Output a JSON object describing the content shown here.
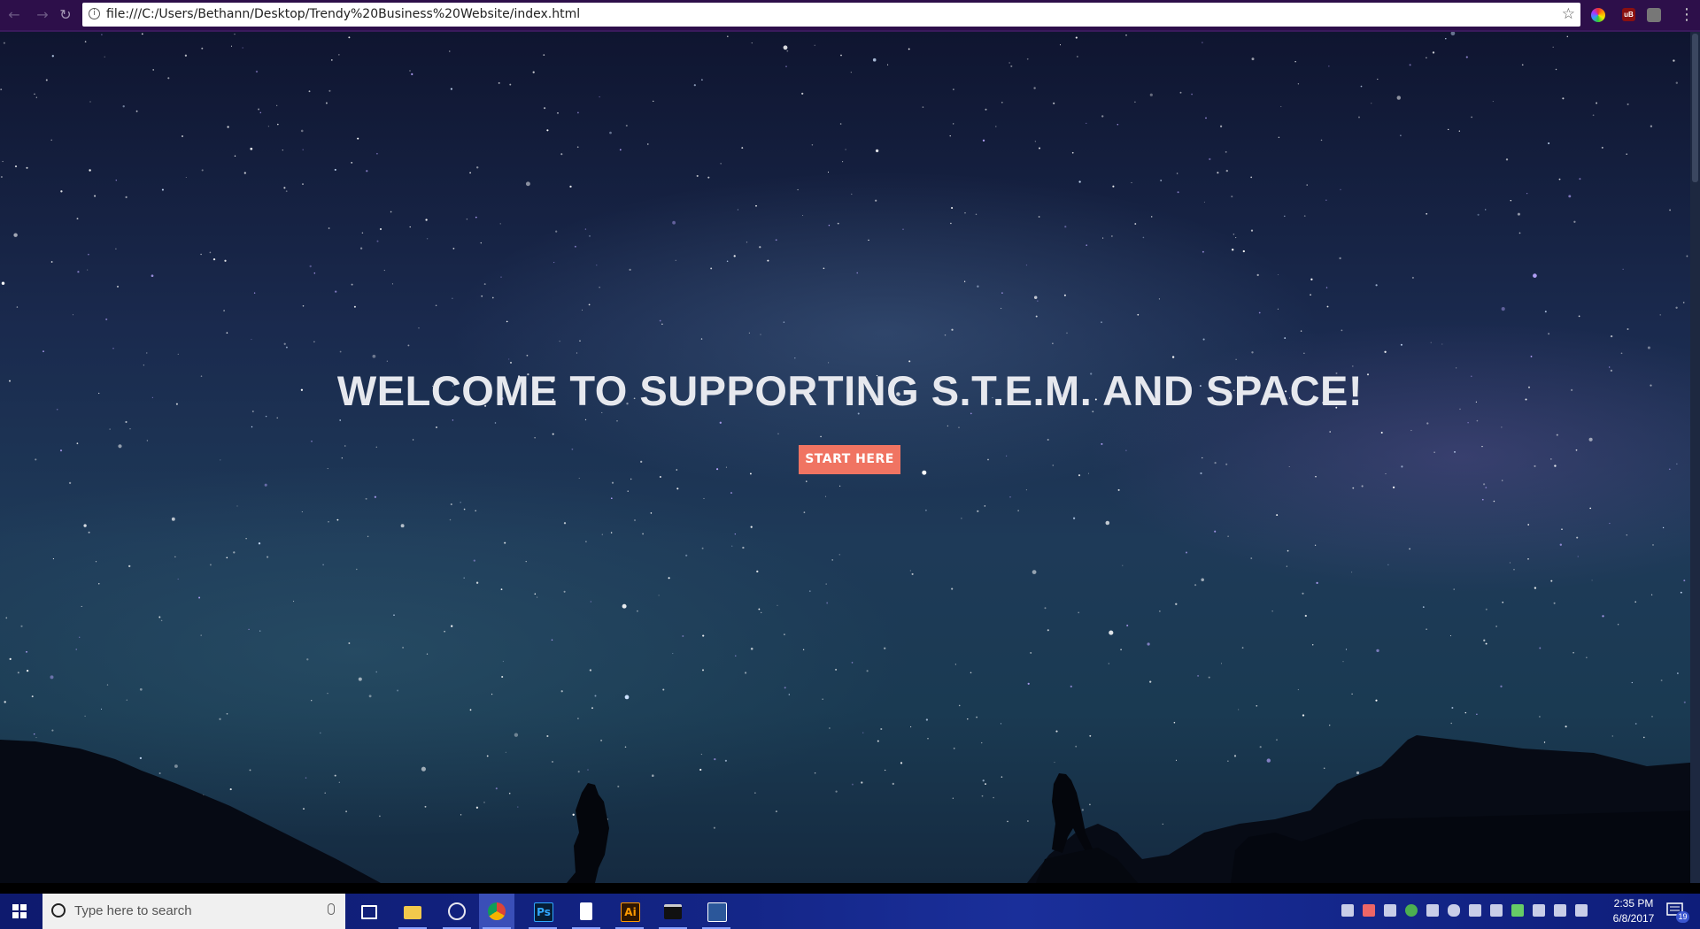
{
  "browser": {
    "url": "file:///C:/Users/Bethann/Desktop/Trendy%20Business%20Website/index.html",
    "back_icon": "arrow-left-icon",
    "forward_icon": "arrow-right-icon",
    "reload_icon": "reload-icon",
    "info_icon": "info-icon",
    "bookmark_icon": "star-icon",
    "extensions": [
      "color-picker-icon",
      "ublock-icon",
      "lock-extension-icon"
    ],
    "ublock_badge": "6",
    "menu_icon": "kebab-menu-icon"
  },
  "hero": {
    "title": "WELCOME TO SUPPORTING S.T.E.M. AND SPACE!",
    "button_label": "START HERE",
    "button_color": "#f07462"
  },
  "taskbar": {
    "search_placeholder": "Type here to search",
    "apps": [
      "task-view-icon",
      "file-explorer-icon",
      "browser-globe-icon",
      "chrome-icon",
      "photoshop-icon",
      "notepad-icon",
      "illustrator-icon",
      "terminal-icon",
      "word-icon"
    ],
    "photoshop_label": "Ps",
    "illustrator_label": "Ai",
    "time": "2:35 PM",
    "date": "6/8/2017",
    "notification_count": "19"
  }
}
